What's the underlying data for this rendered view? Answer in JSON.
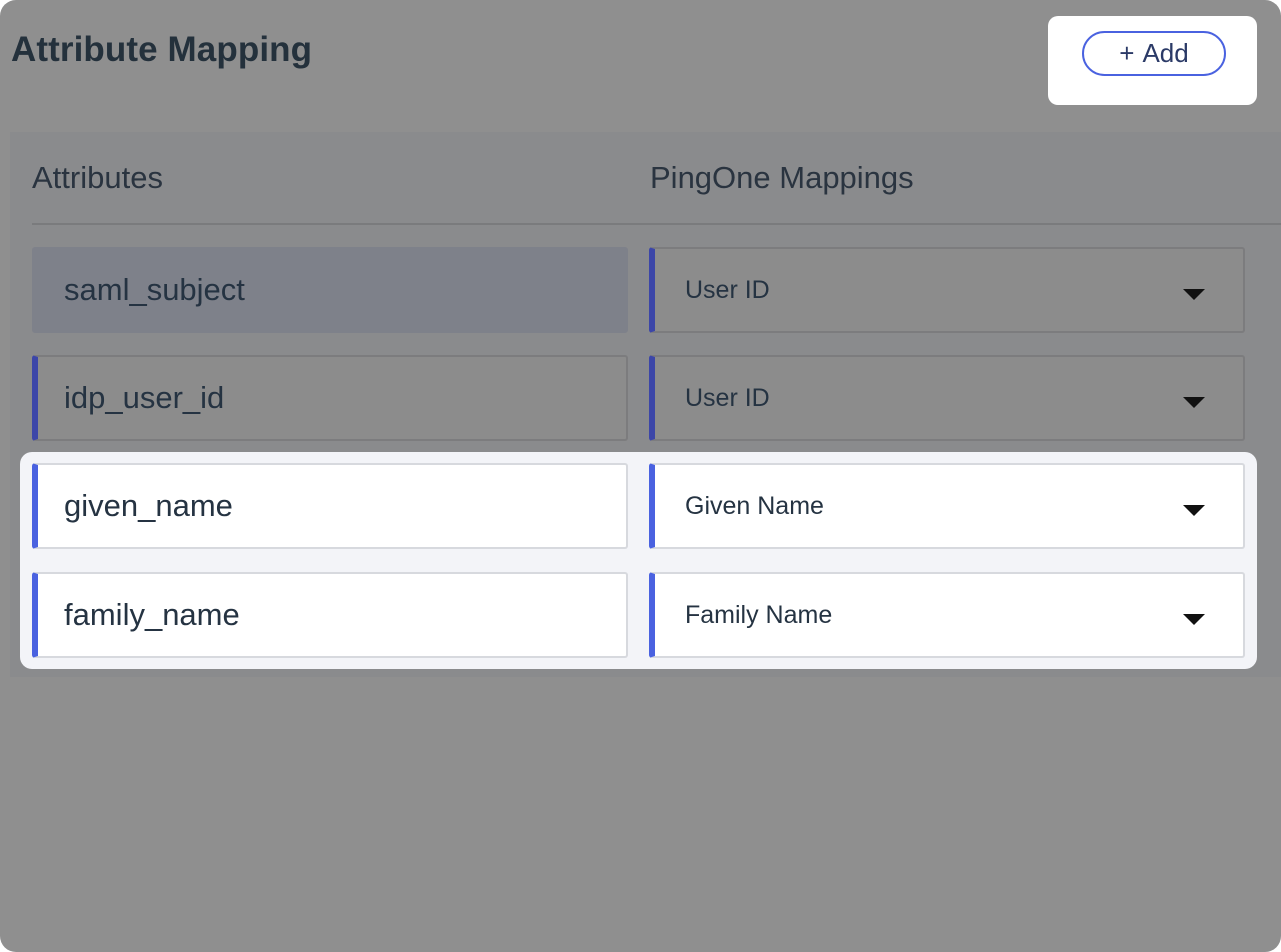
{
  "header": {
    "title": "Attribute Mapping",
    "add_button": {
      "plus": "+",
      "label": "Add"
    }
  },
  "table": {
    "columns": [
      "Attributes",
      "PingOne Mappings"
    ],
    "rows": [
      {
        "attribute": "saml_subject",
        "mapping": "User ID"
      },
      {
        "attribute": "idp_user_id",
        "mapping": "User ID"
      },
      {
        "attribute": "given_name",
        "mapping": "Given Name"
      },
      {
        "attribute": "family_name",
        "mapping": "Family Name"
      }
    ]
  },
  "icons": {
    "dropdown": "caret-down-icon",
    "add": "plus-icon"
  },
  "colors": {
    "accent": "#4a62e0",
    "text": "#253746",
    "overlay": "#8f8f8f",
    "highlight": "#f3f4f8"
  }
}
